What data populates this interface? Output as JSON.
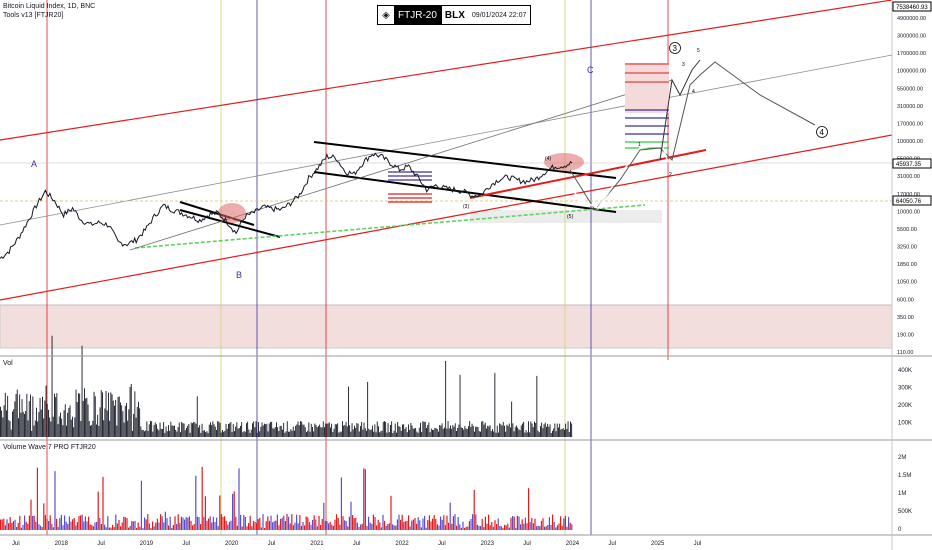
{
  "header": {
    "title": "Bitcoin Liquid Index, 1D, BNC",
    "subtitle": "Tools v13 [FTJR20]"
  },
  "badge": {
    "symbol": "FTJR-20",
    "exchange": "BLX",
    "date": "09/01/2024 22:07"
  },
  "panels": {
    "volume_label": "Vol",
    "wave_label": "Volume Wave 7 PRO FTJR20"
  },
  "annotations": {
    "wave_A": "A",
    "wave_B": "B",
    "wave_C": "C",
    "wave_3": "3",
    "wave_4": "4",
    "small_3": "(3)",
    "small_5": "(5)",
    "small_4": "(4)",
    "tiny_1": "1",
    "tiny_2": "2",
    "tiny_3": "3",
    "tiny_4": "4",
    "tiny_5": "5"
  },
  "colors": {
    "price": "#131722",
    "red": "#e31b1b",
    "green": "#2ecc40",
    "purple": "#3c2fa0",
    "yellow": "#d4cf6a",
    "pinkzone": "#f3dede"
  },
  "chart_data": [
    {
      "type": "line",
      "scale": "log",
      "x_ticks": [
        "Jul",
        "2018",
        "Jul",
        "2019",
        "Jul",
        "2020",
        "Jul",
        "2021",
        "Jul",
        "2022",
        "Jul",
        "2023",
        "Jul",
        "2024",
        "Jul",
        "2025",
        "Jul"
      ],
      "y_ticks": [
        "110.00",
        "190.00",
        "350.00",
        "600.00",
        "1050.00",
        "1850.00",
        "3250.00",
        "5500.00",
        "10000.00",
        "17000.00",
        "31000.00",
        "55000.00",
        "100000.00",
        "170000.00",
        "310000.00",
        "550000.00",
        "1000000.00",
        "1700000.00",
        "3000000.00",
        "4900000.00"
      ],
      "price_labels": [
        "7538460.93",
        "45937.35",
        "64050.76"
      ],
      "series": [
        {
          "values": [
            2200,
            2800,
            4200,
            7000,
            12000,
            19000,
            14000,
            9000,
            11000,
            7500,
            6500,
            7000,
            6400,
            3700,
            3500,
            4000,
            5500,
            8500,
            12000,
            10500,
            9500,
            8500,
            7500,
            9000,
            9500,
            7200,
            5000,
            8500,
            9600,
            11500,
            10800,
            10500,
            13000,
            17000,
            29000,
            40000,
            58000,
            56000,
            36000,
            33000,
            48000,
            63000,
            58000,
            47000,
            38000,
            42000,
            30000,
            20000,
            23000,
            21000,
            20000,
            19000,
            16500,
            17000,
            23000,
            28000,
            30000,
            27000,
            26000,
            28000,
            35000,
            42000,
            43000,
            47000
          ]
        }
      ]
    },
    {
      "type": "bar",
      "y_ticks": [
        "400K",
        "300K",
        "200K",
        "100K"
      ]
    },
    {
      "type": "bar",
      "y_ticks": [
        "2M",
        "1.5M",
        "1M",
        "500K",
        "0"
      ]
    }
  ]
}
